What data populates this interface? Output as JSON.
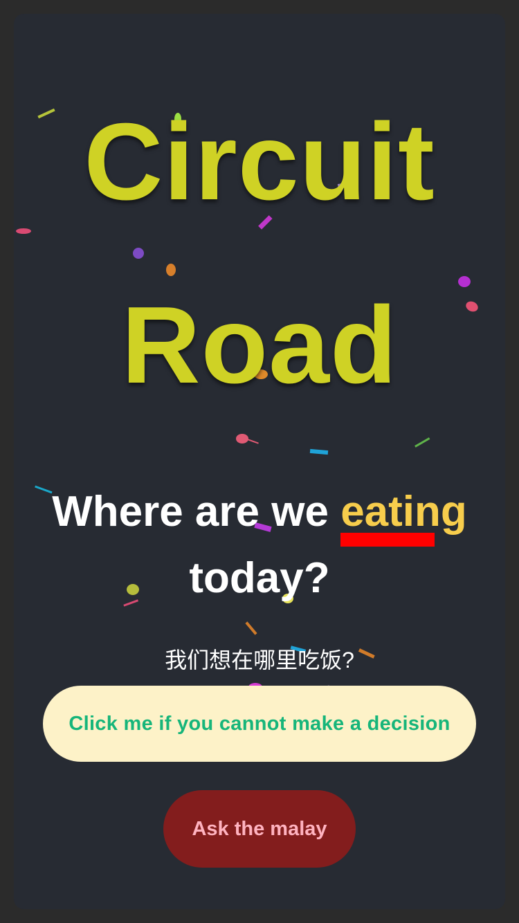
{
  "title": {
    "line1": "Circuit",
    "line2": "Road"
  },
  "question": {
    "before": "Where are we",
    "highlight": "eating",
    "after": "today?"
  },
  "subtitle": "我们想在哪里吃饭?",
  "buttons": {
    "decide": "Click me if you cannot make a decision",
    "malay": "Ask the malay"
  },
  "colors": {
    "title": "#cfd225",
    "highlight": "#f7cd4c",
    "underline": "#ff0000",
    "background": "#272b33",
    "decide_bg": "#fdf2c8",
    "decide_text": "#16b57a",
    "malay_bg": "#831d1d",
    "malay_text": "#ffb3c0"
  }
}
